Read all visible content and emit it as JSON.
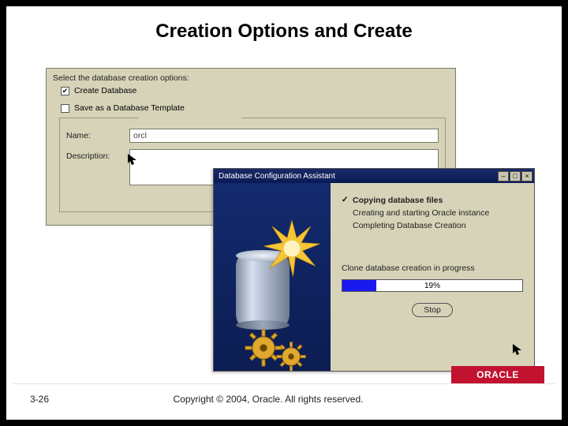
{
  "slide": {
    "title": "Creation Options and Create",
    "page_number": "3-26",
    "copyright": "Copyright © 2004, Oracle. All rights reserved.",
    "brand": "ORACLE"
  },
  "back_window": {
    "instruction": "Select the database creation options:",
    "create_db": {
      "label": "Create Database",
      "checked": true
    },
    "save_template": {
      "label": "Save as a Database Template",
      "checked": false
    },
    "name_label": "Name:",
    "name_value": "orcl",
    "desc_label": "Description:",
    "desc_value": ""
  },
  "front_window": {
    "title": "Database Configuration Assistant",
    "steps": [
      {
        "label": "Copying database files",
        "done": true,
        "bold": true
      },
      {
        "label": "Creating and starting Oracle instance",
        "done": false,
        "bold": false
      },
      {
        "label": "Completing Database Creation",
        "done": false,
        "bold": false
      }
    ],
    "status": "Clone database creation in progress",
    "progress_pct": "19%",
    "stop_label": "Stop"
  },
  "window_buttons": {
    "min": "–",
    "max": "□",
    "close": "×"
  }
}
